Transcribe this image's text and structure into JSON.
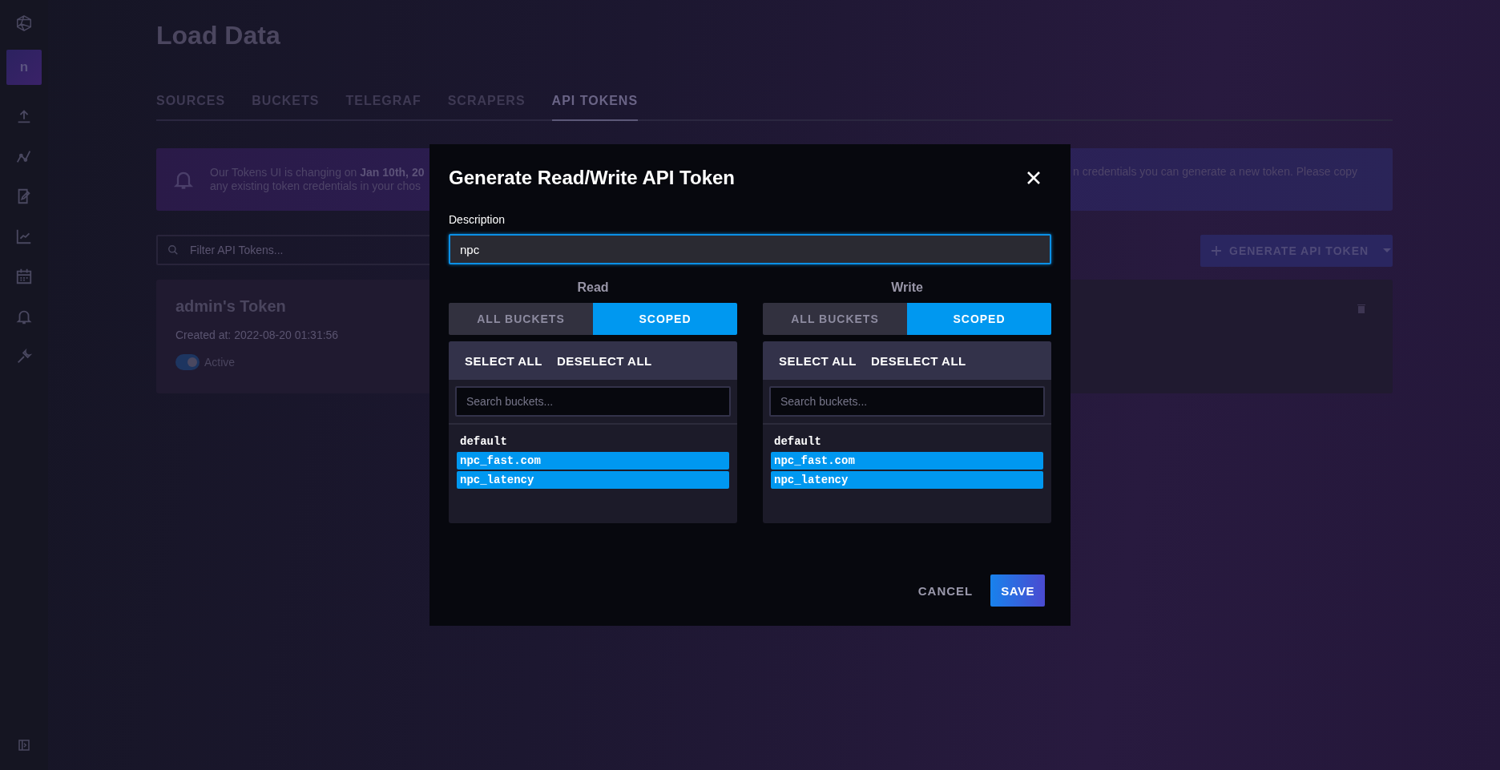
{
  "sidebar": {
    "avatar": "n"
  },
  "page": {
    "title": "Load Data"
  },
  "tabs": [
    {
      "label": "SOURCES",
      "selected": false
    },
    {
      "label": "BUCKETS",
      "selected": false
    },
    {
      "label": "TELEGRAF",
      "selected": false
    },
    {
      "label": "SCRAPERS",
      "selected": false
    },
    {
      "label": "API TOKENS",
      "selected": true
    }
  ],
  "banner": {
    "lines_left": [
      "Our Tokens UI is changing on **Jan 10th, 20**",
      "any existing token credentials in your chos"
    ],
    "text_right": "n credentials you can generate a new token. Please copy"
  },
  "filter": {
    "placeholder": "Filter API Tokens..."
  },
  "generate_button": "GENERATE API TOKEN",
  "token": {
    "name": "admin's Token",
    "created": "Created at: 2022-08-20 01:31:56",
    "status": "Active",
    "on": true
  },
  "modal": {
    "title": "Generate Read/Write API Token",
    "description_label": "Description",
    "description_value": "npc",
    "sections": [
      {
        "heading": "Read",
        "modes": [
          {
            "label": "ALL BUCKETS",
            "selected": false
          },
          {
            "label": "SCOPED",
            "selected": true
          }
        ],
        "select_all": "SELECT ALL",
        "deselect_all": "DESELECT ALL",
        "search": {
          "placeholder": "Search buckets..."
        },
        "buckets": [
          {
            "name": "default",
            "selected": false
          },
          {
            "name": "npc_fast.com",
            "selected": true
          },
          {
            "name": "npc_latency",
            "selected": true
          }
        ]
      },
      {
        "heading": "Write",
        "modes": [
          {
            "label": "ALL BUCKETS",
            "selected": false
          },
          {
            "label": "SCOPED",
            "selected": true
          }
        ],
        "select_all": "SELECT ALL",
        "deselect_all": "DESELECT ALL",
        "search": {
          "placeholder": "Search buckets..."
        },
        "buckets": [
          {
            "name": "default",
            "selected": false
          },
          {
            "name": "npc_fast.com",
            "selected": true
          },
          {
            "name": "npc_latency",
            "selected": true
          }
        ]
      }
    ],
    "cancel": "CANCEL",
    "save": "SAVE"
  }
}
